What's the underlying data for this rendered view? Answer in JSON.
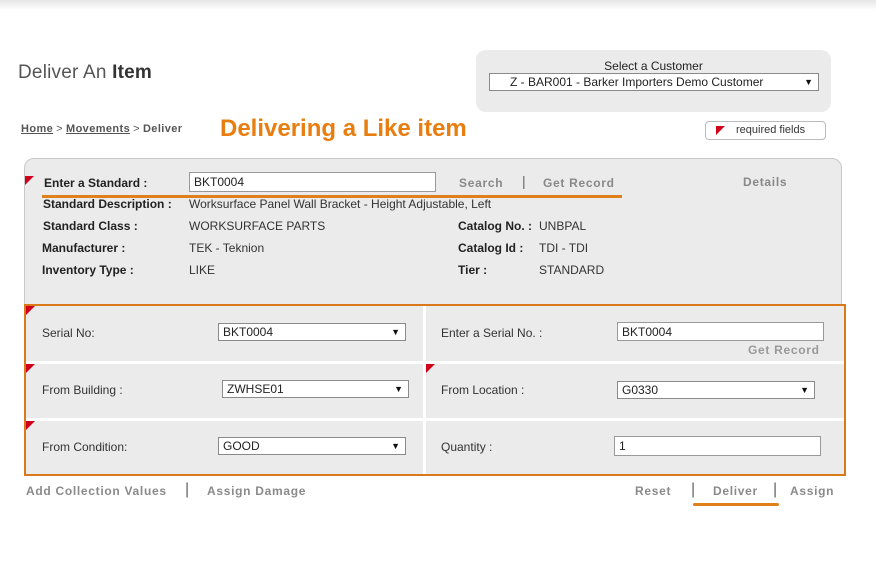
{
  "page": {
    "title_prefix": "Deliver An",
    "title_bold": "Item"
  },
  "customer": {
    "label": "Select a Customer",
    "selected": "Z - BAR001 - Barker Importers Demo Customer"
  },
  "breadcrumb": {
    "home": "Home",
    "movements": "Movements",
    "current": "Deliver",
    "separator": ">"
  },
  "annotation": {
    "title": "Delivering a Like item",
    "color": "#e87e10"
  },
  "required": {
    "label": "required fields",
    "flag_color": "#d0021b"
  },
  "standard": {
    "label": "Enter a Standard :",
    "value": "BKT0004",
    "search": "Search",
    "get_record": "Get Record",
    "details": "Details"
  },
  "info": {
    "description_label": "Standard Description :",
    "description_value": "Worksurface Panel Wall Bracket - Height Adjustable, Left",
    "class_label": "Standard Class :",
    "class_value": "WORKSURFACE PARTS",
    "manufacturer_label": "Manufacturer :",
    "manufacturer_value": "TEK - Teknion",
    "inventory_label": "Inventory Type :",
    "inventory_value": "LIKE",
    "catalog_no_label": "Catalog No. :",
    "catalog_no_value": "UNBPAL",
    "catalog_id_label": "Catalog Id :",
    "catalog_id_value": "TDI - TDI",
    "tier_label": "Tier :",
    "tier_value": "STANDARD"
  },
  "form": {
    "serial_no_label": "Serial No:",
    "serial_no_value": "BKT0004",
    "enter_serial_label": "Enter a Serial No. :",
    "enter_serial_value": "BKT0004",
    "get_record": "Get Record",
    "from_building_label": "From Building :",
    "from_building_value": "ZWHSE01",
    "from_location_label": "From Location :",
    "from_location_value": "G0330",
    "from_condition_label": "From Condition:",
    "from_condition_value": "GOOD",
    "quantity_label": "Quantity :",
    "quantity_value": "1"
  },
  "actions": {
    "add_collection": "Add Collection Values",
    "assign_damage": "Assign Damage",
    "reset": "Reset",
    "deliver": "Deliver",
    "assign": "Assign",
    "divider": "|"
  },
  "icons": {
    "dropdown": "chevron-down-icon",
    "arrow_glyph": "▼"
  }
}
